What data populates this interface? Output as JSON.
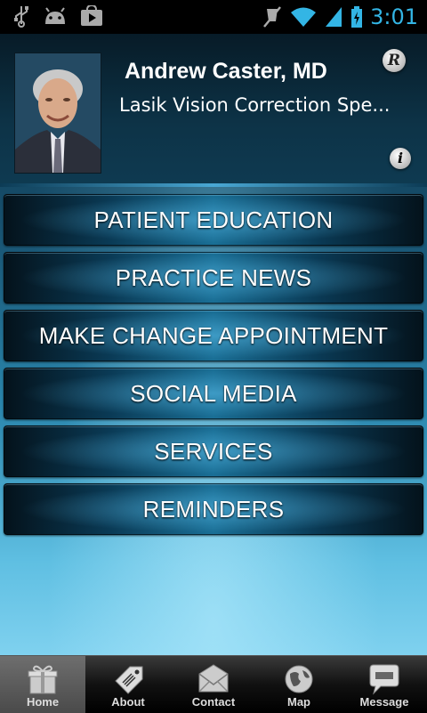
{
  "status_bar": {
    "time": "3:01",
    "left_icons": [
      "usb-icon",
      "android-icon",
      "play-store-icon"
    ],
    "right_icons": [
      "mute-icon",
      "wifi-icon",
      "signal-icon",
      "battery-icon"
    ]
  },
  "profile": {
    "name": "Andrew Caster, MD",
    "title": "Lasik Vision Correction Spe...",
    "r_badge": "R",
    "info_badge": "i"
  },
  "menu": {
    "items": [
      {
        "label": "PATIENT EDUCATION"
      },
      {
        "label": "PRACTICE NEWS"
      },
      {
        "label": "MAKE CHANGE APPOINTMENT"
      },
      {
        "label": "SOCIAL MEDIA"
      },
      {
        "label": "SERVICES"
      },
      {
        "label": "REMINDERS"
      }
    ]
  },
  "tabs": {
    "items": [
      {
        "label": "Home",
        "icon": "gift-icon",
        "active": true
      },
      {
        "label": "About",
        "icon": "tag-icon",
        "active": false
      },
      {
        "label": "Contact",
        "icon": "envelope-icon",
        "active": false
      },
      {
        "label": "Map",
        "icon": "globe-icon",
        "active": false
      },
      {
        "label": "Message",
        "icon": "chat-bubble-icon",
        "active": false
      }
    ]
  },
  "colors": {
    "accent": "#33b5e5",
    "header_bg": "#0d3347",
    "button_center": "#1a6f96"
  }
}
